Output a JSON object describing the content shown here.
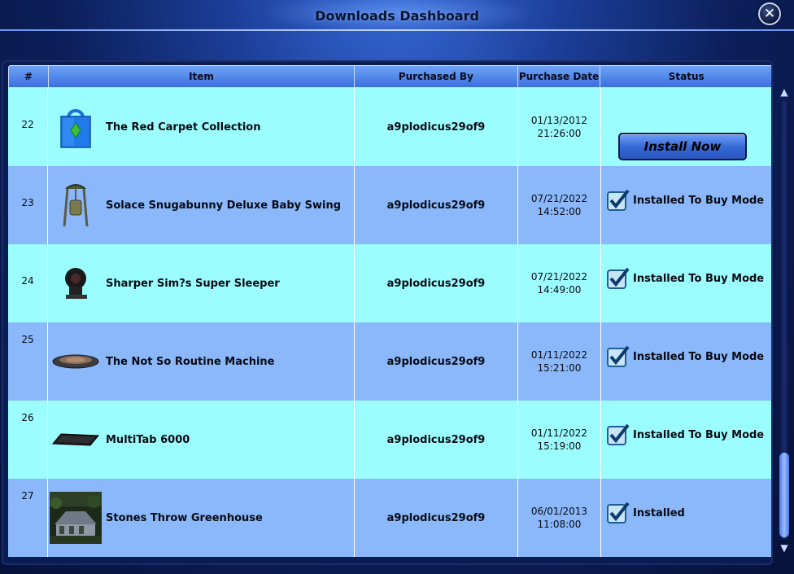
{
  "window": {
    "title": "Downloads Dashboard",
    "close_label": "✕"
  },
  "table": {
    "columns": [
      "#",
      "Item",
      "Purchased By",
      "Purchase Date",
      "Status"
    ],
    "rows": [
      {
        "num": "22",
        "item": "The Red Carpet Collection",
        "icon": "shopping-bag-icon",
        "buyer": "a9plodicus29of9",
        "date": "01/13/2012",
        "time": "21:26:00",
        "status": "",
        "button": "Install Now"
      },
      {
        "num": "23",
        "item": "Solace Snugabunny Deluxe Baby Swing",
        "icon": "baby-swing-icon",
        "buyer": "a9plodicus29of9",
        "date": "07/21/2022",
        "time": "14:52:00",
        "status": "Installed To Buy Mode"
      },
      {
        "num": "24",
        "item": "Sharper Sim?s Super Sleeper",
        "icon": "super-sleeper-icon",
        "buyer": "a9plodicus29of9",
        "date": "07/21/2022",
        "time": "14:49:00",
        "status": "Installed To Buy Mode"
      },
      {
        "num": "25",
        "item": "The Not So Routine Machine",
        "icon": "routine-machine-icon",
        "buyer": "a9plodicus29of9",
        "date": "01/11/2022",
        "time": "15:21:00",
        "status": "Installed To Buy Mode"
      },
      {
        "num": "26",
        "item": "MultiTab 6000",
        "icon": "multitab-icon",
        "buyer": "a9plodicus29of9",
        "date": "01/11/2022",
        "time": "15:19:00",
        "status": "Installed To Buy Mode"
      },
      {
        "num": "27",
        "item": "Stones Throw Greenhouse",
        "icon": "greenhouse-thumbnail",
        "buyer": "a9plodicus29of9",
        "date": "06/01/2013",
        "time": "11:08:00",
        "status": "Installed"
      }
    ]
  },
  "scrollbar": {
    "up": "▲",
    "down": "▼"
  },
  "colors": {
    "row_light": "#9bfdfd",
    "row_dark": "#8ab8fa",
    "header": "#5a8ef0"
  }
}
